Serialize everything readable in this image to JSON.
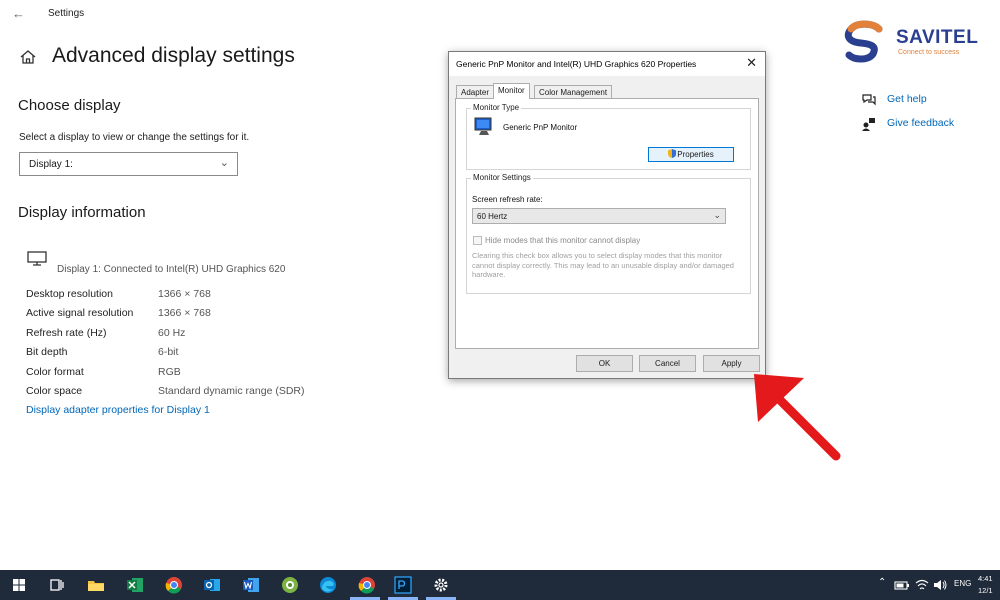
{
  "app": {
    "title": "Settings"
  },
  "page": {
    "title": "Advanced display settings",
    "choose_display_heading": "Choose display",
    "choose_display_desc": "Select a display to view or change the settings for it.",
    "display_select_value": "Display 1:",
    "display_info_heading": "Display information",
    "connection_text": "Display 1: Connected to Intel(R) UHD Graphics 620",
    "info_rows": [
      {
        "label": "Desktop resolution",
        "value": "1366 × 768"
      },
      {
        "label": "Active signal resolution",
        "value": "1366 × 768"
      },
      {
        "label": "Refresh rate (Hz)",
        "value": "60 Hz"
      },
      {
        "label": "Bit depth",
        "value": "6-bit"
      },
      {
        "label": "Color format",
        "value": "RGB"
      },
      {
        "label": "Color space",
        "value": "Standard dynamic range (SDR)"
      }
    ],
    "adapter_link": "Display adapter properties for Display 1"
  },
  "side_links": {
    "help": "Get help",
    "feedback": "Give feedback"
  },
  "logo": {
    "name": "SAVITEL",
    "tagline": "Connect to success"
  },
  "dialog": {
    "title": "Generic PnP Monitor and Intel(R) UHD Graphics 620 Properties",
    "tabs": [
      "Adapter",
      "Monitor",
      "Color Management"
    ],
    "monitor_type_label": "Monitor Type",
    "monitor_name": "Generic PnP Monitor",
    "properties_button": "Properties",
    "monitor_settings_label": "Monitor Settings",
    "refresh_rate_label": "Screen refresh rate:",
    "refresh_rate_value": "60 Hertz",
    "hide_modes_label": "Hide modes that this monitor cannot display",
    "hide_modes_note": "Clearing this check box allows you to select display modes that this monitor cannot display correctly. This may lead to an unusable display and/or damaged hardware.",
    "ok": "OK",
    "cancel": "Cancel",
    "apply": "Apply"
  },
  "taskbar": {
    "tray_lang": "ENG",
    "clock_time": "4:41",
    "clock_date": "12/1"
  },
  "colors": {
    "accent_link": "#0067b8",
    "taskbar": "#1f2a3a",
    "arrow": "#e3191c",
    "logo_blue": "#2a3f8f",
    "logo_orange": "#e2813a"
  }
}
